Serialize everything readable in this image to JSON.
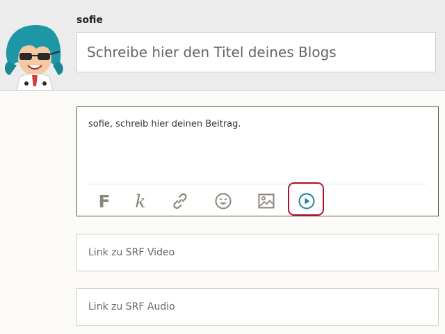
{
  "user": {
    "name": "sofie"
  },
  "blog": {
    "title_placeholder": "Schreibe hier den Titel deines Blogs"
  },
  "editor": {
    "prompt": "sofie, schreib hier deinen Beitrag.",
    "toolbar": {
      "bold_glyph": "F",
      "italic_glyph": "k",
      "tools": [
        "bold-icon",
        "italic-icon",
        "link-icon",
        "emoji-icon",
        "image-icon",
        "video-play-icon"
      ],
      "highlighted_tool": "video-play-icon"
    }
  },
  "media_links": {
    "video_placeholder": "Link zu SRF Video",
    "audio_placeholder": "Link zu SRF Audio"
  },
  "colors": {
    "accent_teal": "#2a7f9e",
    "highlight_red": "#b0122a",
    "icon_gray": "#8a857a",
    "header_bg": "#ececec"
  }
}
